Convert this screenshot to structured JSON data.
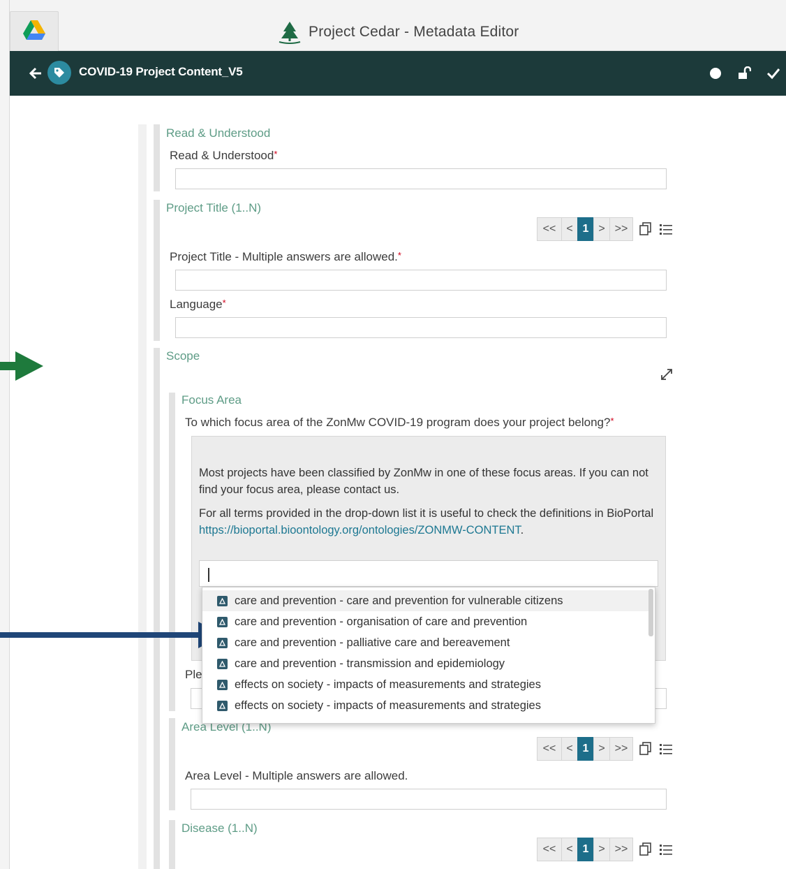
{
  "app": {
    "title": "Project Cedar - Metadata Editor",
    "brand_color": "#1c3a3a",
    "accent_color": "#5e9c86",
    "link_color": "#1d7892",
    "page_active_color": "#1d6e8a",
    "tab_icon": "google-drive-icon",
    "title_icon": "cedar-tree-icon"
  },
  "navbar": {
    "title": "COVID-19 Project Content_V5",
    "icons": [
      "back-arrow-icon",
      "tag-icon",
      "dot-icon",
      "unlock-icon",
      "check-icon"
    ]
  },
  "form": {
    "read_section": {
      "title": "Read & Understood",
      "field_label": "Read & Understood",
      "field_value": ""
    },
    "project_title_section": {
      "title": "Project Title (1..N)",
      "pager": {
        "first": "<<",
        "prev": "<",
        "page": "1",
        "next": ">",
        "last": ">>"
      },
      "field_label": "Project Title - Multiple answers are allowed.",
      "language_label": "Language"
    },
    "scope_section": {
      "title": "Scope",
      "focus_area": {
        "title": "Focus Area",
        "question": "To which focus area of the ZonMw COVID-19 program does your project belong?",
        "help_paragraph_1": "Most projects have been classified by ZonMw in one of these focus areas. If you can not find your focus area, please contact us.",
        "help_paragraph_2_prefix": "For all terms provided in the drop-down list it is useful to check the definitions in BioPortal",
        "help_link": "https://bioportal.bioontology.org/ontologies/ZONMW-CONTENT",
        "help_paragraph_2_suffix": ".",
        "search_value": "",
        "partial_label": "Ple"
      },
      "dropdown_options": [
        "care and prevention - care and prevention for vulnerable citizens",
        "care and prevention - organisation of care and prevention",
        "care and prevention - palliative care and bereavement",
        "care and prevention - transmission and epidemiology",
        "effects on society - impacts of measurements and strategies",
        "effects on society - impacts of measurements and strategies"
      ],
      "area_level": {
        "title": "Area Level (1..N)",
        "pager": {
          "first": "<<",
          "prev": "<",
          "page": "1",
          "next": ">",
          "last": ">>"
        },
        "field_label": "Area Level - Multiple answers are allowed."
      },
      "disease": {
        "title": "Disease (1..N)",
        "pager": {
          "first": "<<",
          "prev": "<",
          "page": "1",
          "next": ">",
          "last": ">>"
        }
      }
    }
  },
  "annotations": {
    "green_arrow_color": "#1e7a3c",
    "blue_arrow_color": "#1f4678"
  }
}
